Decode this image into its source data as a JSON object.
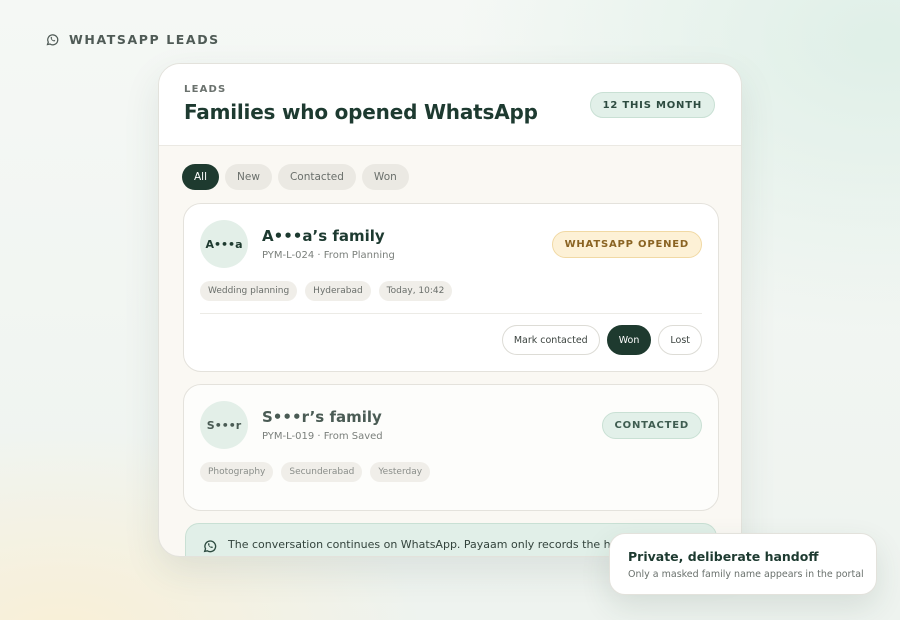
{
  "header": {
    "icon": "whatsapp-icon",
    "label": "WHATSAPP LEADS"
  },
  "card": {
    "kicker": "LEADS",
    "title": "Families who opened WhatsApp",
    "month_badge": "12 THIS MONTH"
  },
  "filters": [
    {
      "label": "All",
      "active": true
    },
    {
      "label": "New",
      "active": false
    },
    {
      "label": "Contacted",
      "active": false
    },
    {
      "label": "Won",
      "active": false
    }
  ],
  "leads": [
    {
      "initials": "A•••a",
      "name": "A•••a’s family",
      "meta": "PYM-L-024 · From Planning",
      "status": "WHATSAPP OPENED",
      "tags": [
        "Wedding planning",
        "Hyderabad",
        "Today, 10:42"
      ],
      "actions": [
        "Mark contacted",
        "Won",
        "Lost"
      ]
    },
    {
      "initials": "S•••r",
      "name": "S•••r’s family",
      "meta": "PYM-L-019 · From Saved",
      "status": "CONTACTED",
      "tags": [
        "Photography",
        "Secunderabad",
        "Yesterday"
      ]
    }
  ],
  "banner": {
    "icon": "whatsapp-icon",
    "text": "The conversation continues on WhatsApp. Payaam only records the handoff."
  },
  "toast": {
    "title": "Private, deliberate handoff",
    "subtitle": "Only a masked family name appears in the portal"
  },
  "colors": {
    "accent": "#1e3a2f",
    "opened_badge": "#fdf1d6",
    "contacted_badge": "#e2f0e9"
  }
}
